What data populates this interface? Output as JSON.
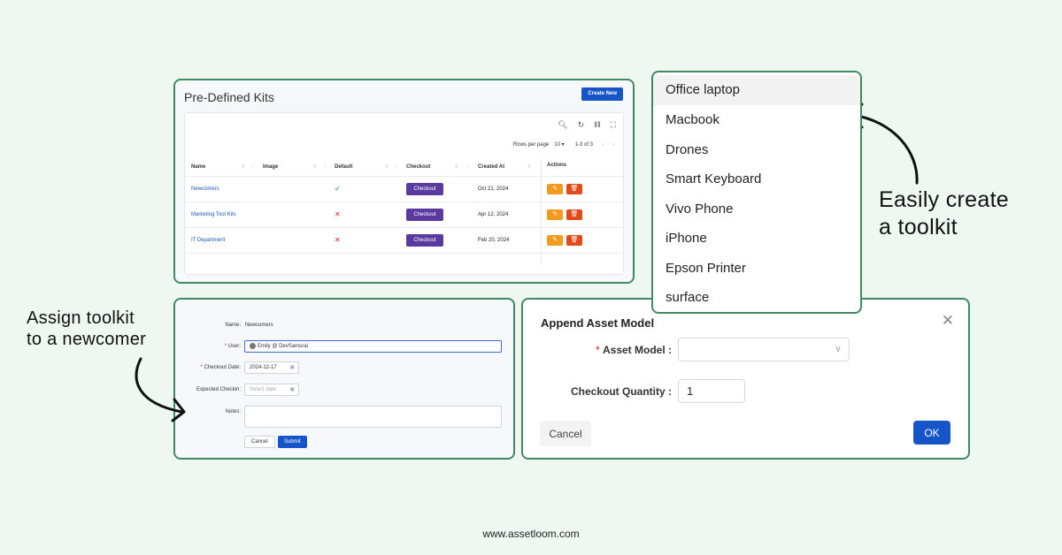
{
  "kits": {
    "title": "Pre-Defined Kits",
    "create_label": "Create New",
    "toolbar_icons": [
      "search-icon",
      "refresh-icon",
      "columns-icon",
      "fullscreen-icon"
    ],
    "pagination": {
      "rows_label": "Rows per page",
      "rows_value": "10",
      "range": "1-3 of 3"
    },
    "columns": [
      "Name",
      "Image",
      "Default",
      "Checkout",
      "Created At",
      "Actions"
    ],
    "rows": [
      {
        "name": "Newcomers",
        "default": "✓",
        "checkout": "Checkout",
        "created": "Oct 21, 2024"
      },
      {
        "name": "Marketing Tool Kits",
        "default": "✕",
        "checkout": "Checkout",
        "created": "Apr 12, 2024"
      },
      {
        "name": "IT Department",
        "default": "✕",
        "checkout": "Checkout",
        "created": "Feb 20, 2024"
      }
    ]
  },
  "dropdown": {
    "items": [
      "Office laptop",
      "Macbook",
      "Drones",
      "Smart Keyboard",
      "Vivo Phone",
      "iPhone",
      "Epson Printer",
      "surface"
    ],
    "selected_index": 0
  },
  "assign": {
    "name_label": "Name:",
    "name_value": "Newcomers",
    "user_label": "User:",
    "user_value": "Emily @ DevSamurai",
    "checkout_date_label": "Checkout Date:",
    "checkout_date_value": "2024-12-17",
    "expected_checkin_label": "Expected Checkin:",
    "expected_checkin_placeholder": "Select date",
    "notes_label": "Notes:",
    "cancel_label": "Cancel",
    "submit_label": "Submit"
  },
  "append": {
    "title": "Append Asset Model",
    "asset_model_label": "Asset Model :",
    "quantity_label": "Checkout Quantity :",
    "quantity_value": "1",
    "cancel_label": "Cancel",
    "ok_label": "OK"
  },
  "captions": {
    "right_line1": "Easily create",
    "right_line2": "a toolkit",
    "left_line1": "Assign toolkit",
    "left_line2": "to a newcomer"
  },
  "footer": "www.assetloom.com",
  "colors": {
    "background": "#eef8f1",
    "border": "#3f8a63",
    "primary": "#1555c8",
    "checkout": "#5b3aa0",
    "edit": "#f29b1e",
    "delete": "#e24a1a"
  }
}
